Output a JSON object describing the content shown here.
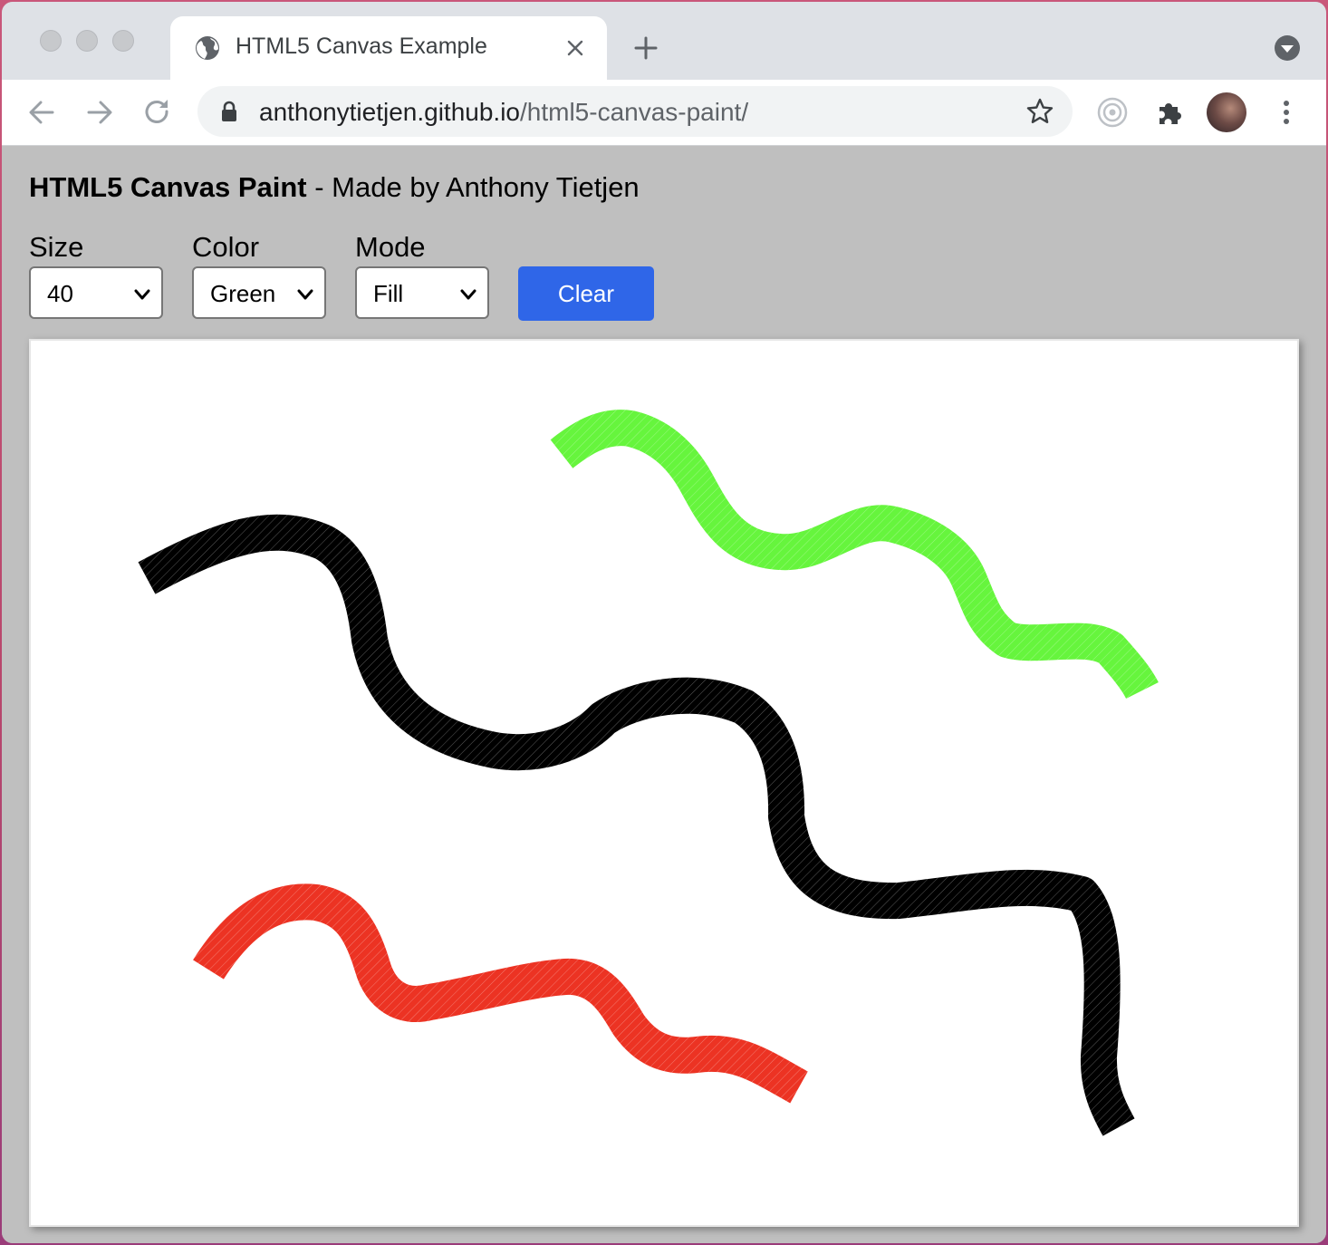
{
  "browser": {
    "tab": {
      "title": "HTML5 Canvas Example",
      "icon": "globe-icon"
    },
    "url": {
      "host": "anthonytietjen.github.io",
      "path": "/html5-canvas-paint/"
    }
  },
  "page": {
    "title_bold": "HTML5 Canvas Paint",
    "title_rest": " - Made by Anthony Tietjen",
    "controls": {
      "size": {
        "label": "Size",
        "value": "40"
      },
      "color": {
        "label": "Color",
        "value": "Green"
      },
      "mode": {
        "label": "Mode",
        "value": "Fill"
      },
      "clear_label": "Clear"
    }
  },
  "canvas": {
    "strokes": [
      {
        "color": "Black",
        "hex": "#000000"
      },
      {
        "color": "Green",
        "hex": "#66f53d"
      },
      {
        "color": "Red",
        "hex": "#ec3323"
      }
    ]
  },
  "colors": {
    "accent": "#2f66e8",
    "page_background": "#bfbfbf"
  }
}
